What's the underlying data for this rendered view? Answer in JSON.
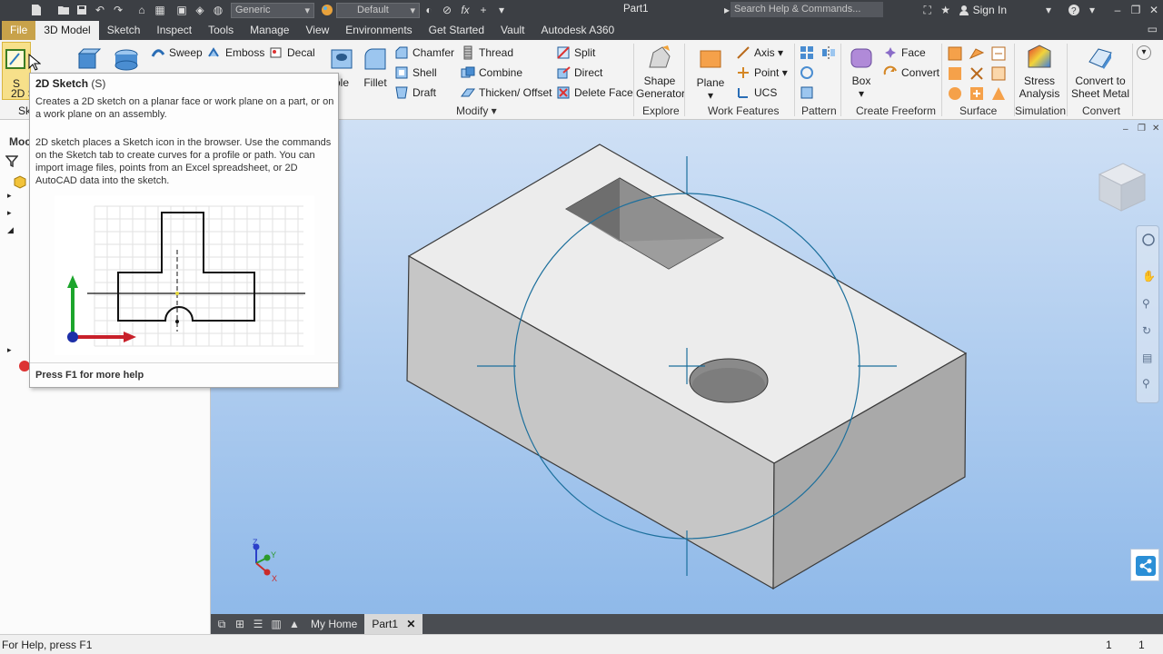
{
  "titlebar": {
    "material_combo": "Generic",
    "appearance_combo": "Default",
    "doc_title": "Part1",
    "search_placeholder": "Search Help & Commands...",
    "sign_in": "Sign In"
  },
  "menu": {
    "file": "File",
    "tabs": [
      "3D Model",
      "Sketch",
      "Inspect",
      "Tools",
      "Manage",
      "View",
      "Environments",
      "Get Started",
      "Vault",
      "Autodesk A360"
    ]
  },
  "ribbon": {
    "sketch_short1": "S",
    "sketch_short2": "2D S",
    "sketch_panel_short": "Sk",
    "sweep": "Sweep",
    "emboss": "Emboss",
    "decal": "Decal",
    "hole_partial": "ole",
    "fillet": "Fillet",
    "chamfer": "Chamfer",
    "thread": "Thread",
    "split": "Split",
    "shell": "Shell",
    "combine": "Combine",
    "direct": "Direct",
    "draft": "Draft",
    "thicken": "Thicken/ Offset",
    "delete_face": "Delete Face",
    "modify_label": "Modify",
    "shape_generator": [
      "Shape",
      "Generator"
    ],
    "explore_label": "Explore",
    "plane": "Plane",
    "axis": "Axis",
    "point": "Point",
    "ucs": "UCS",
    "work_features_label": "Work Features",
    "pattern_label": "Pattern",
    "box": "Box",
    "face": "Face",
    "convert": "Convert",
    "create_freeform_label": "Create Freeform",
    "surface_label": "Surface",
    "stress_analysis": [
      "Stress",
      "Analysis"
    ],
    "simulation_label": "Simulation",
    "convert_sheet_metal": [
      "Convert to",
      "Sheet Metal"
    ],
    "convert_label": "Convert"
  },
  "browser": {
    "title_partial": "Moc"
  },
  "tooltip": {
    "title": "2D Sketch",
    "shortcut": "(S)",
    "summary": "Creates a 2D sketch on a planar face or work plane on a part, or on a work plane on an assembly.",
    "detail": "2D sketch places a Sketch icon in the browser. Use the commands on the Sketch tab to create curves for a profile or path. You can import image files, points from an Excel spreadsheet, or 2D AutoCAD data into the sketch.",
    "footer": "Press F1 for more help"
  },
  "triad": {
    "z": "Z",
    "y": "Y",
    "x": "X"
  },
  "doctabs": {
    "home": "My Home",
    "part": "Part1"
  },
  "status": {
    "help": "For Help, press F1",
    "count1": "1",
    "count2": "1"
  },
  "colors": {
    "titlebar": "#3c3f44",
    "file_tab": "#c8a24a",
    "viewport_top": "#cfe0f5",
    "viewport_bottom": "#8fb9e9",
    "sketch_circle": "#1c6f9c"
  }
}
